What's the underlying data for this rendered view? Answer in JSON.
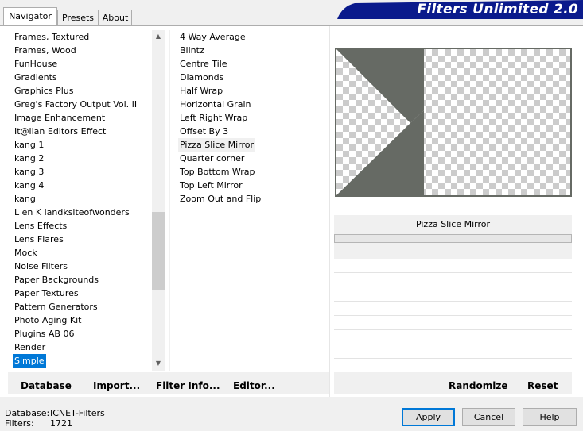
{
  "tabs": [
    "Navigator",
    "Presets",
    "About"
  ],
  "app_title": "Filters Unlimited 2.0",
  "categories": [
    "Frames, Textured",
    "Frames, Wood",
    "FunHouse",
    "Gradients",
    "Graphics Plus",
    "Greg's Factory Output Vol. II",
    "Image Enhancement",
    "It@lian Editors Effect",
    "kang 1",
    "kang 2",
    "kang 3",
    "kang 4",
    "kang",
    "L en K landksiteofwonders",
    "Lens Effects",
    "Lens Flares",
    "Mock",
    "Noise Filters",
    "Paper Backgrounds",
    "Paper Textures",
    "Pattern Generators",
    "Photo Aging Kit",
    "Plugins AB 06",
    "Render",
    "Simple"
  ],
  "selected_category": "Simple",
  "filters": [
    "4 Way Average",
    "Blintz",
    "Centre Tile",
    "Diamonds",
    "Half Wrap",
    "Horizontal Grain",
    "Left Right Wrap",
    "Offset By 3",
    "Pizza Slice Mirror",
    "Quarter corner",
    "Top Bottom Wrap",
    "Top Left Mirror",
    "Zoom Out and Flip"
  ],
  "selected_filter": "Pizza Slice Mirror",
  "filter_name_label": "Pizza Slice Mirror",
  "bottom_buttons": {
    "database": "Database",
    "import": "Import...",
    "filter_info": "Filter Info...",
    "editor": "Editor...",
    "randomize": "Randomize",
    "reset": "Reset"
  },
  "footer": {
    "database_label": "Database:",
    "database_value": "ICNET-Filters",
    "filters_label": "Filters:",
    "filters_value": "1721"
  },
  "dialog_buttons": {
    "apply": "Apply",
    "cancel": "Cancel",
    "help": "Help"
  },
  "colors": {
    "selection": "#0078d7",
    "banner": "#0a1a8c",
    "preview_shape": "#666a64"
  }
}
